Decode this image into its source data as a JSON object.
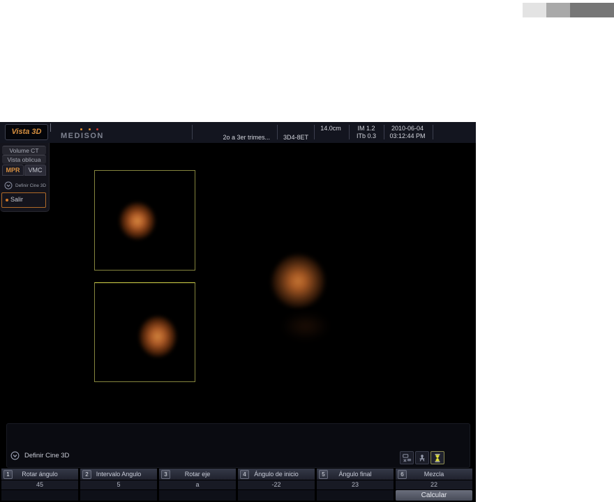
{
  "header": {
    "mode": "Vista 3D",
    "brand": "MEDISON",
    "application": "2o a 3er trimes...",
    "transducer": "3D4-8ET",
    "depth": "14.0cm",
    "mi": "IM 1.2",
    "ti": "ITb 0.3",
    "date": "2010-06-04",
    "time": "03:12:44 PM"
  },
  "sidebar": {
    "volume_ct": "Volume CT",
    "vista_oblicua": "Vista oblicua",
    "tab_mpr": "MPR",
    "tab_vmc": "VMC",
    "cine_label": "Definir Cine 3D",
    "exit_label": "Salir"
  },
  "bottom": {
    "section_label": "Definir Cine 3D",
    "icon_names": [
      "hide-text-icon",
      "pointer-select-icon",
      "hourglass-icon"
    ],
    "controls": [
      {
        "num": "1",
        "label": "Rotar ángulo",
        "value": "45"
      },
      {
        "num": "2",
        "label": "Intervalo Angulo",
        "value": "5"
      },
      {
        "num": "3",
        "label": "Rotar eje",
        "value": "a"
      },
      {
        "num": "4",
        "label": "Ángulo de inicio",
        "value": "-22"
      },
      {
        "num": "5",
        "label": "Ángulo final",
        "value": "23"
      },
      {
        "num": "6",
        "label": "Mezcla",
        "value": "22"
      }
    ],
    "calculate_label": "Calcular"
  },
  "colors": {
    "accent_orange": "#d89040",
    "box_border_yellow": "#85853e",
    "header_bg": "#13151f",
    "hourglass_yellow": "#e6e63c"
  }
}
